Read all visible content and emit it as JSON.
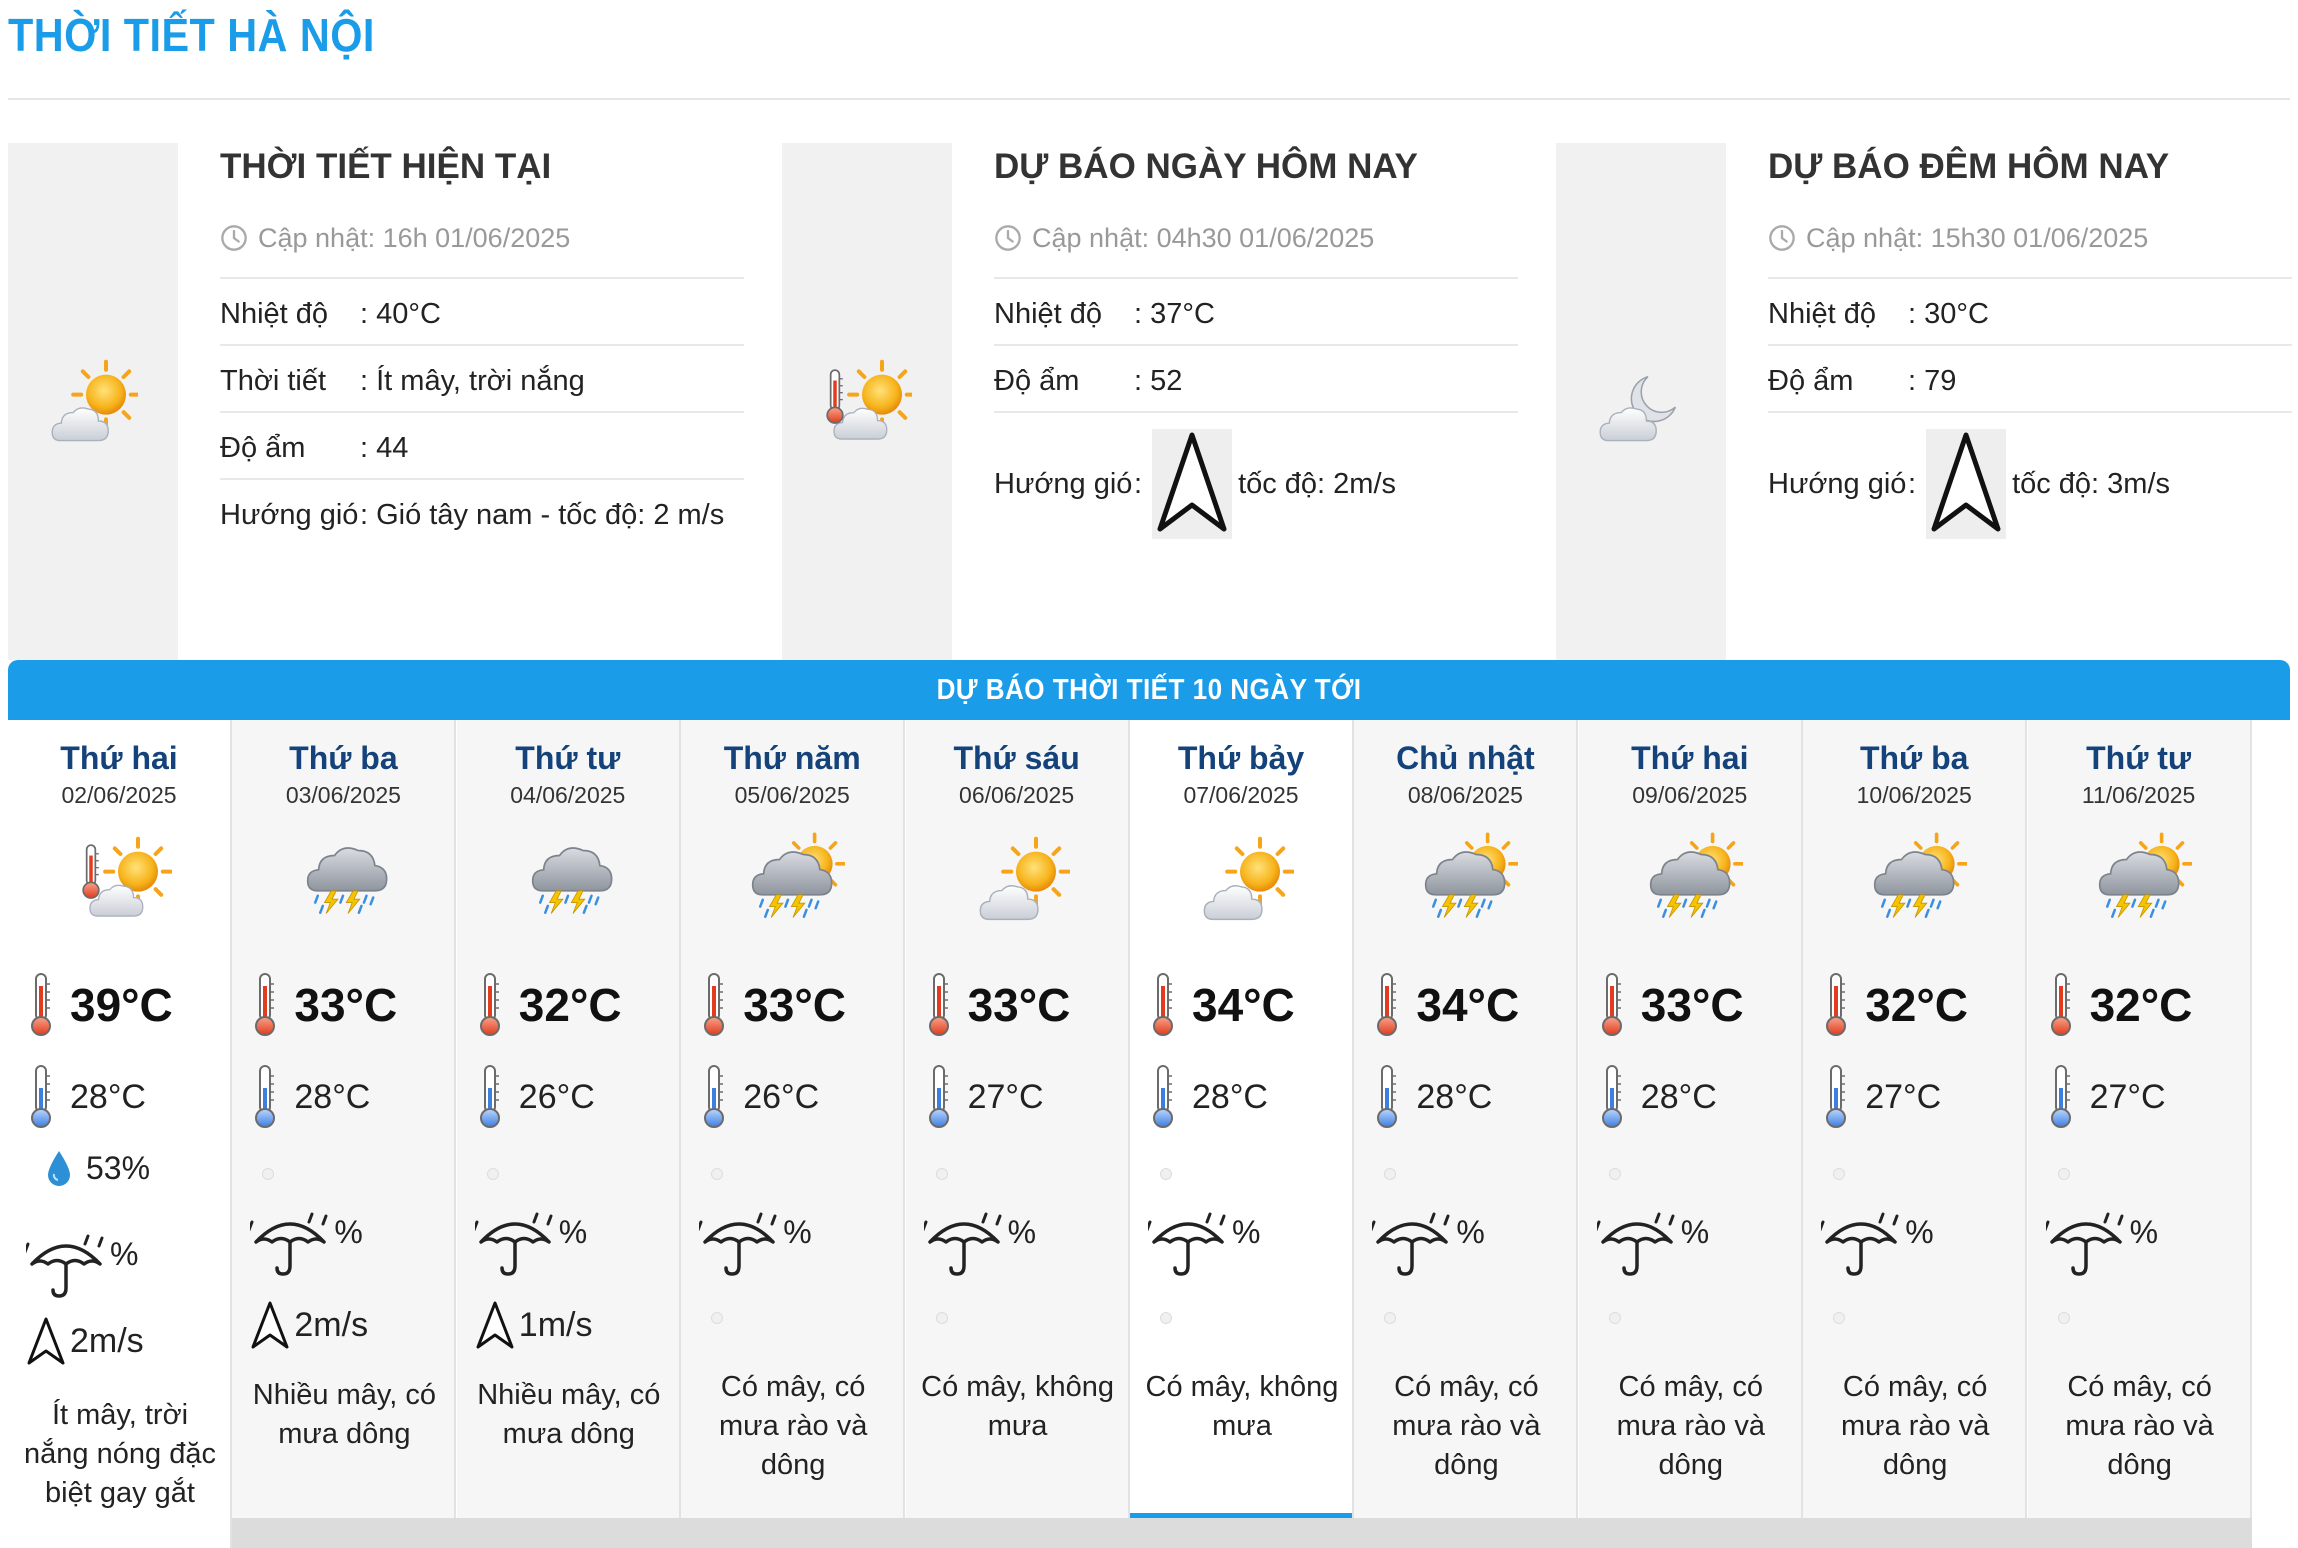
{
  "page": {
    "title": "THỜI TIẾT HÀ NỘI"
  },
  "colors": {
    "accent": "#1a9ce8",
    "day_name": "#14427a"
  },
  "current": {
    "heading": "THỜI TIẾT HIỆN TẠI",
    "updated": "Cập nhật: 16h 01/06/2025",
    "icon": "sun-cloud-icon",
    "rows": [
      {
        "label": "Nhiệt độ",
        "value": ": 40°C"
      },
      {
        "label": "Thời tiết",
        "value": ": Ít mây, trời nắng"
      },
      {
        "label": "Độ ẩm",
        "value": ": 44"
      },
      {
        "label": "Hướng gió",
        "value": ": Gió tây nam - tốc độ: 2 m/s"
      }
    ]
  },
  "today": {
    "heading": "DỰ BÁO NGÀY HÔM NAY",
    "updated": "Cập nhật: 04h30 01/06/2025",
    "icon": "hot-sun-cloud-icon",
    "temp_label": "Nhiệt độ",
    "temp_value": ": 37°C",
    "humidity_label": "Độ ẩm",
    "humidity_value": ": 52",
    "wind_label": "Hướng gió",
    "wind_sep": ":",
    "wind_speed": "tốc độ: 2m/s"
  },
  "tonight": {
    "heading": "DỰ BÁO ĐÊM HÔM NAY",
    "updated": "Cập nhật: 15h30 01/06/2025",
    "icon": "moon-cloud-icon",
    "temp_label": "Nhiệt độ",
    "temp_value": ": 30°C",
    "humidity_label": "Độ ẩm",
    "humidity_value": ": 79",
    "wind_label": "Hướng gió",
    "wind_sep": ":",
    "wind_speed": "tốc độ: 3m/s"
  },
  "forecast": {
    "header": "DỰ BÁO THỜI TIẾT 10 NGÀY TỚI",
    "days": [
      {
        "name": "Thứ hai",
        "date": "02/06/2025",
        "icon": "hot-sun-cloud-icon",
        "high": "39°C",
        "low": "28°C",
        "humidity": "53%",
        "rain": "%",
        "wind": "2m/s",
        "desc": "Ít mây, trời nắng nóng đặc biệt gay gắt"
      },
      {
        "name": "Thứ ba",
        "date": "03/06/2025",
        "icon": "thunderstorm-icon",
        "high": "33°C",
        "low": "28°C",
        "humidity": "",
        "rain": "%",
        "wind": "2m/s",
        "desc": "Nhiều mây, có mưa dông"
      },
      {
        "name": "Thứ tư",
        "date": "04/06/2025",
        "icon": "thunderstorm-icon",
        "high": "32°C",
        "low": "26°C",
        "humidity": "",
        "rain": "%",
        "wind": "1m/s",
        "desc": "Nhiều mây, có mưa dông"
      },
      {
        "name": "Thứ năm",
        "date": "05/06/2025",
        "icon": "sun-thunderstorm-icon",
        "high": "33°C",
        "low": "26°C",
        "humidity": "",
        "rain": "%",
        "wind": "",
        "desc": "Có mây, có mưa rào và dông"
      },
      {
        "name": "Thứ sáu",
        "date": "06/06/2025",
        "icon": "sun-cloud-icon",
        "high": "33°C",
        "low": "27°C",
        "humidity": "",
        "rain": "%",
        "wind": "",
        "desc": "Có mây, không mưa"
      },
      {
        "name": "Thứ bảy",
        "date": "07/06/2025",
        "icon": "sun-cloud-icon",
        "high": "34°C",
        "low": "28°C",
        "humidity": "",
        "rain": "%",
        "wind": "",
        "desc": "Có mây, không mưa"
      },
      {
        "name": "Chủ nhật",
        "date": "08/06/2025",
        "icon": "sun-thunderstorm-icon",
        "high": "34°C",
        "low": "28°C",
        "humidity": "",
        "rain": "%",
        "wind": "",
        "desc": "Có mây, có mưa rào và dông"
      },
      {
        "name": "Thứ hai",
        "date": "09/06/2025",
        "icon": "sun-thunderstorm-icon",
        "high": "33°C",
        "low": "28°C",
        "humidity": "",
        "rain": "%",
        "wind": "",
        "desc": "Có mây, có mưa rào và dông"
      },
      {
        "name": "Thứ ba",
        "date": "10/06/2025",
        "icon": "sun-thunderstorm-icon",
        "high": "32°C",
        "low": "27°C",
        "humidity": "",
        "rain": "%",
        "wind": "",
        "desc": "Có mây, có mưa rào và dông"
      },
      {
        "name": "Thứ tư",
        "date": "11/06/2025",
        "icon": "sun-thunderstorm-icon",
        "high": "32°C",
        "low": "27°C",
        "humidity": "",
        "rain": "%",
        "wind": "",
        "desc": "Có mây, có mưa rào và dông"
      }
    ]
  }
}
